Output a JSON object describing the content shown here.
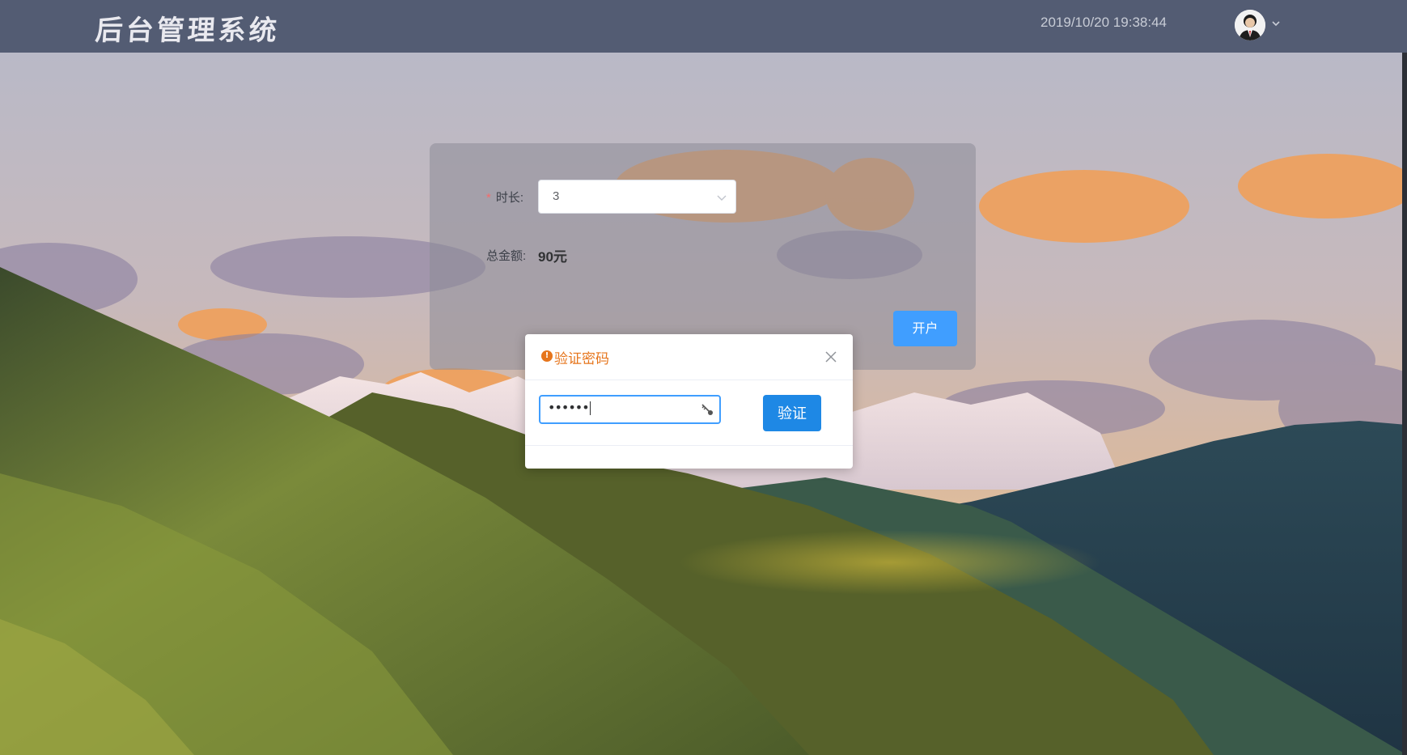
{
  "header": {
    "brand": "后台管理系统",
    "datetime": "2019/10/20 19:38:44"
  },
  "form": {
    "duration_label": "时长:",
    "required_mark": "*",
    "duration_value": "3",
    "total_label": "总金额:",
    "total_value": "90元",
    "open_button": "开户"
  },
  "dialog": {
    "title": "验证密码",
    "password_mask": "••••••",
    "verify_button": "验证"
  },
  "icons": {
    "avatar": "user-avatar",
    "caret": "chevron-down-icon",
    "select_arrow": "chevron-down-icon",
    "warning": "info-circle-icon",
    "close": "close-icon",
    "password_reveal": "key-icon"
  },
  "colors": {
    "header_bg": "#535c73",
    "primary": "#409eff",
    "warning": "#e6751c"
  }
}
